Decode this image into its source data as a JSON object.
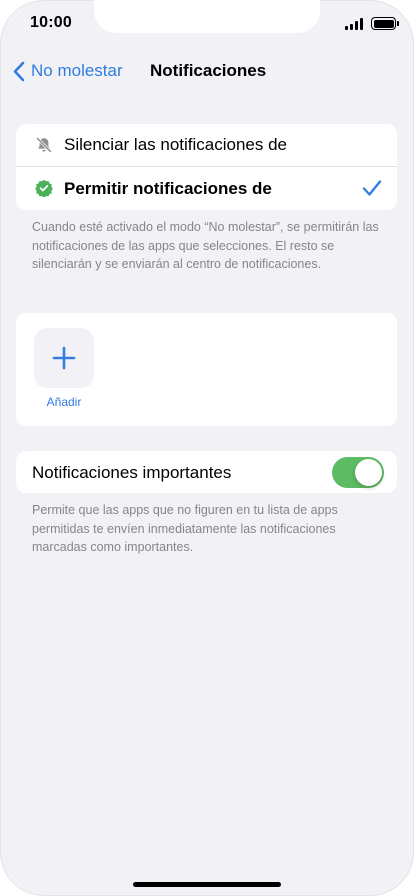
{
  "status_bar": {
    "time": "10:00"
  },
  "nav": {
    "back_label": "No molestar",
    "title": "Notificaciones"
  },
  "mode_options": [
    {
      "label": "Silenciar las notificaciones de",
      "icon": "bell-slash-icon",
      "selected": false
    },
    {
      "label": "Permitir notificaciones de",
      "icon": "verified-badge-icon",
      "selected": true
    }
  ],
  "mode_footnote": "Cuando esté activado el modo “No molestar”, se permitirán las notificaciones de las apps que selecciones. El resto se silenciarán y se enviarán al centro de notificaciones.",
  "apps": {
    "add_label": "Añadir"
  },
  "important": {
    "label": "Notificaciones importantes",
    "enabled": true
  },
  "important_footnote": "Permite que las apps que no figuren en tu lista de apps permitidas te envíen inmediatamente las notificaciones marcadas como importantes.",
  "colors": {
    "accent": "#2f7de1",
    "toggle_on": "#5dbb63",
    "badge_green": "#4cb05a",
    "background": "#f2f1f6",
    "footnote": "#86858b"
  }
}
